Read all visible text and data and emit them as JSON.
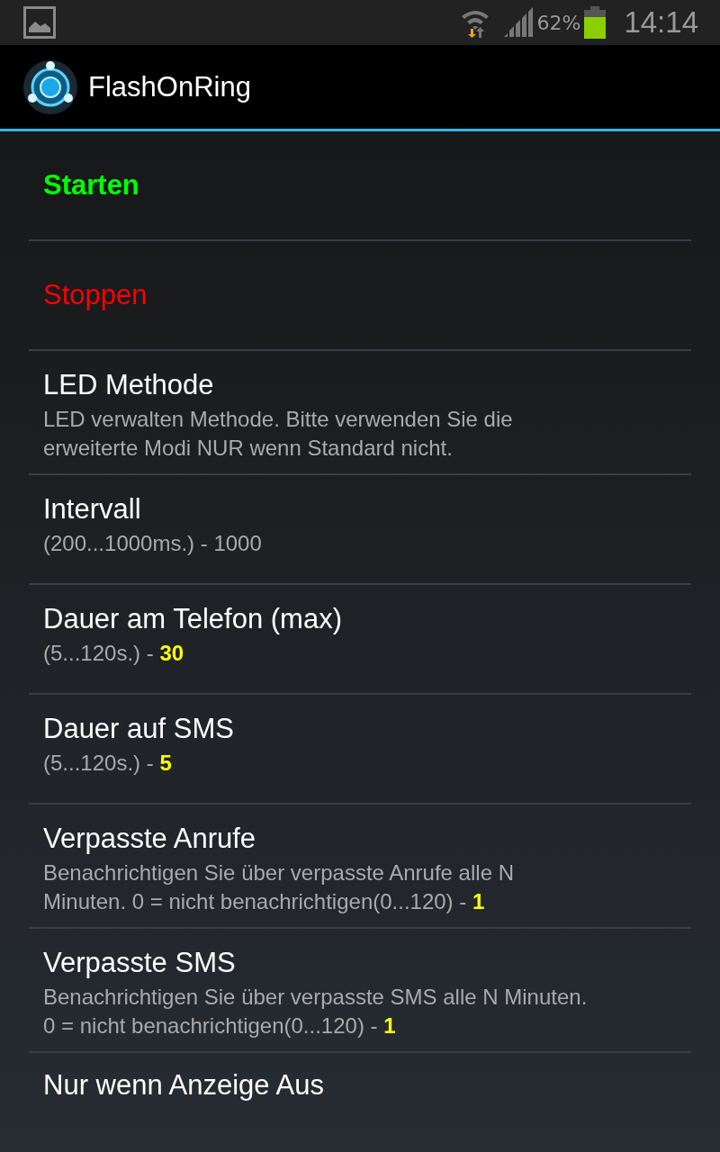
{
  "status_bar": {
    "battery_percent": "62%",
    "time": "14:14"
  },
  "app_bar": {
    "title": "FlashOnRing"
  },
  "items": [
    {
      "kind": "action",
      "title": "Starten",
      "color": "#00ff00",
      "bold": true
    },
    {
      "kind": "action",
      "title": "Stoppen",
      "color": "#ff0000",
      "bold": false
    },
    {
      "kind": "setting",
      "title": "LED Methode",
      "summary": "LED verwalten Methode. Bitte verwenden Sie die erweiterte Modi NUR wenn Standard nicht."
    },
    {
      "kind": "setting",
      "title": "Intervall",
      "summary": "(200...1000ms.) - 1000"
    },
    {
      "kind": "setting",
      "title": "Dauer am Telefon (max)",
      "summary": "(5...120s.) - **30**"
    },
    {
      "kind": "setting",
      "title": "Dauer auf SMS",
      "summary": "(5...120s.) - **5**"
    },
    {
      "kind": "setting",
      "title": "Verpasste Anrufe",
      "summary": "Benachrichtigen Sie über verpasste Anrufe alle N Minuten. 0 = nicht benachrichtigen(0...120) - **1**"
    },
    {
      "kind": "setting",
      "title": "Verpasste SMS",
      "summary": "Benachrichtigen Sie über verpasste SMS alle N Minuten. 0 = nicht benachrichtigen(0...120) - **1**"
    },
    {
      "kind": "setting",
      "title": "Nur wenn Anzeige Aus"
    }
  ]
}
